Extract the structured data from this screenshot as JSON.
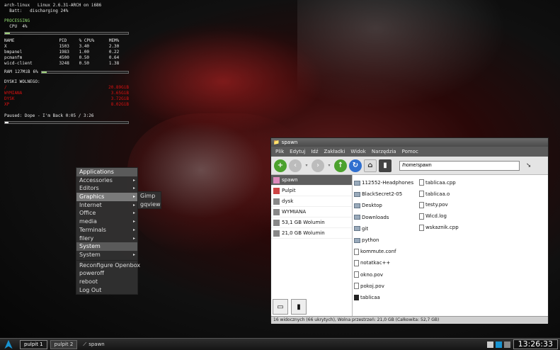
{
  "conky": {
    "host": "arch-linux",
    "kernel": "Linux 2.6.31-ARCH on i686",
    "battery_label": "Batt:",
    "battery_status": "discharging 24%",
    "processing_label": "PROCESSING",
    "cpu_label": "CPU",
    "cpu_value": "4%",
    "cpu_fraction": 0.04,
    "table_headers": [
      "NAME",
      "PID",
      "% CPU%",
      "MEM%"
    ],
    "processes": [
      {
        "name": "X",
        "pid": "1503",
        "cpu": "3.40",
        "mem": "2.30"
      },
      {
        "name": "bmpanel",
        "pid": "1983",
        "cpu": "1.00",
        "mem": "0.22"
      },
      {
        "name": "pcmanfm",
        "pid": "4500",
        "cpu": "0.50",
        "mem": "0.64"
      },
      {
        "name": "wicd-client",
        "pid": "3248",
        "cpu": "0.50",
        "mem": "1.38"
      }
    ],
    "ram_label": "RAM",
    "ram_value": "127MiB",
    "ram_pct": "6%",
    "ram_fraction": 0.06,
    "disks_label": "DYSKI WOLNEGO:",
    "disks": [
      {
        "name": "/",
        "value": "20.89GiB"
      },
      {
        "name": "WYMIANA",
        "value": "3.65GiB"
      },
      {
        "name": "DYSK",
        "value": "3.72GiB"
      },
      {
        "name": "XP",
        "value": "8.02GiB"
      }
    ],
    "music": "Paused: Dope - I'm Back 0:05 / 3:26",
    "music_fraction": 0.03
  },
  "menu": {
    "items": [
      {
        "label": "Applications",
        "type": "title",
        "arrow": ""
      },
      {
        "label": "Accessories",
        "type": "item",
        "arrow": "▸"
      },
      {
        "label": "Editors",
        "type": "item",
        "arrow": "▸"
      },
      {
        "label": "Graphics",
        "type": "sel",
        "arrow": "▸"
      },
      {
        "label": "Internet",
        "type": "item",
        "arrow": "▸"
      },
      {
        "label": "Office",
        "type": "item",
        "arrow": "▸"
      },
      {
        "label": "media",
        "type": "item",
        "arrow": "▸"
      },
      {
        "label": "Terminals",
        "type": "item",
        "arrow": "▸"
      },
      {
        "label": "filery",
        "type": "item",
        "arrow": "▸"
      },
      {
        "label": "System",
        "type": "title",
        "arrow": ""
      },
      {
        "label": "System",
        "type": "item",
        "arrow": "▸"
      },
      {
        "label": "",
        "type": "sep",
        "arrow": ""
      },
      {
        "label": "Reconfigure Openbox",
        "type": "item",
        "arrow": ""
      },
      {
        "label": "poweroff",
        "type": "item",
        "arrow": ""
      },
      {
        "label": "reboot",
        "type": "item",
        "arrow": ""
      },
      {
        "label": "Log Out",
        "type": "item",
        "arrow": ""
      }
    ],
    "submenu": [
      "Gimp",
      "gqview"
    ]
  },
  "window": {
    "title": "spawn",
    "menubar": [
      "Plik",
      "Edytuj",
      "Idź",
      "Zakładki",
      "Widok",
      "Narzędzia",
      "Pomoc"
    ],
    "path": "/home/spawn",
    "places": [
      {
        "label": "spawn",
        "icon": "home-icon",
        "selected": true
      },
      {
        "label": "Pulpit",
        "icon": "desktop-icon",
        "selected": false
      },
      {
        "label": "dysk",
        "icon": "drive-icon",
        "selected": false
      },
      {
        "label": "WYMIANA",
        "icon": "drive-icon",
        "selected": false
      },
      {
        "label": "53,1 GB Wolumin",
        "icon": "drive-icon",
        "selected": false
      },
      {
        "label": "21,0 GB Wolumin",
        "icon": "drive-icon",
        "selected": false
      }
    ],
    "files_col1": [
      {
        "name": "112552-Headphones",
        "icon": "folder"
      },
      {
        "name": "BlackSecret2-05",
        "icon": "folder"
      },
      {
        "name": "Desktop",
        "icon": "folder"
      },
      {
        "name": "Downloads",
        "icon": "folder"
      },
      {
        "name": "git",
        "icon": "folder"
      },
      {
        "name": "python",
        "icon": "folder"
      },
      {
        "name": "kommute.conf",
        "icon": "doc"
      },
      {
        "name": "notatkac++",
        "icon": "doc"
      },
      {
        "name": "okno.pov",
        "icon": "doc"
      },
      {
        "name": "pokoj.pov",
        "icon": "doc"
      },
      {
        "name": "tablicaa",
        "icon": "bin"
      }
    ],
    "files_col2": [
      {
        "name": "tablicaa.cpp",
        "icon": "doc"
      },
      {
        "name": "tablicaa.o",
        "icon": "doc"
      },
      {
        "name": "testy.pov",
        "icon": "doc"
      },
      {
        "name": "Wicd.log",
        "icon": "doc"
      },
      {
        "name": "wskaznik.cpp",
        "icon": "doc"
      }
    ],
    "status": "16 widocznych (66 ukrytych), Wolna przestrzeń: 21,0 GB (Całkowita: 52,7 GB)"
  },
  "taskbar": {
    "desktops": [
      "pulpit 1",
      "pulpit 2"
    ],
    "task": "spawn",
    "clock": "13:26:33"
  },
  "colors": {
    "conky_green": "#8fd66f",
    "conky_red": "#d11",
    "accent_blue": "#2f6fcf"
  }
}
